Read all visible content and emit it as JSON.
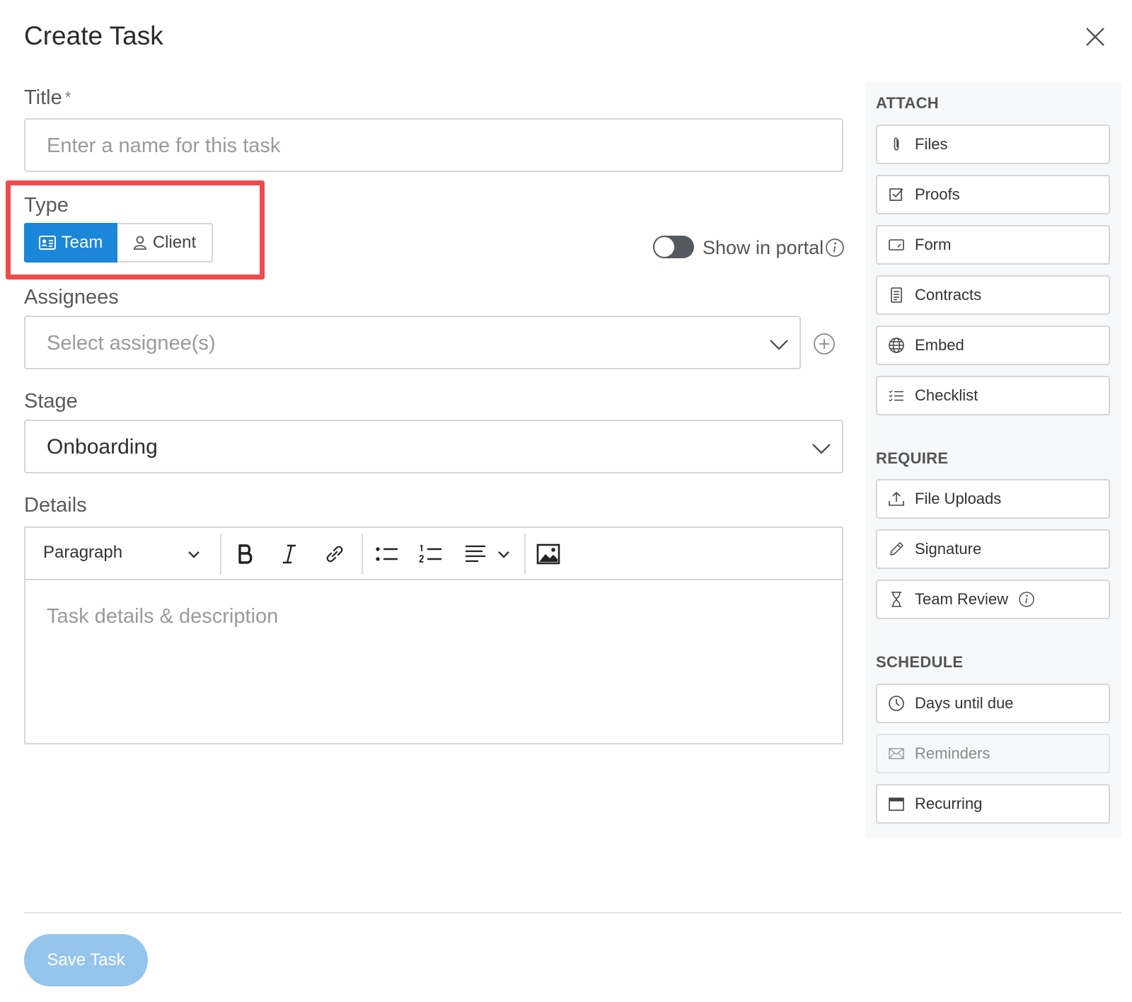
{
  "dialog": {
    "title": "Create Task"
  },
  "title_field": {
    "label": "Title",
    "required_mark": "*",
    "placeholder": "Enter a name for this task"
  },
  "type_field": {
    "label": "Type",
    "options": [
      {
        "label": "Team",
        "selected": true
      },
      {
        "label": "Client",
        "selected": false
      }
    ]
  },
  "portal": {
    "label": "Show in portal",
    "enabled": false
  },
  "assignees": {
    "label": "Assignees",
    "placeholder": "Select assignee(s)"
  },
  "stage": {
    "label": "Stage",
    "value": "Onboarding"
  },
  "details": {
    "label": "Details",
    "block_format": "Paragraph",
    "placeholder": "Task details & description"
  },
  "sidebar": {
    "attach": {
      "heading": "ATTACH",
      "items": [
        {
          "label": "Files",
          "icon": "paperclip-icon"
        },
        {
          "label": "Proofs",
          "icon": "checkbox-icon"
        },
        {
          "label": "Form",
          "icon": "form-icon"
        },
        {
          "label": "Contracts",
          "icon": "document-icon"
        },
        {
          "label": "Embed",
          "icon": "globe-icon"
        },
        {
          "label": "Checklist",
          "icon": "list-check-icon"
        }
      ]
    },
    "require": {
      "heading": "REQUIRE",
      "items": [
        {
          "label": "File Uploads",
          "icon": "upload-icon"
        },
        {
          "label": "Signature",
          "icon": "pen-icon"
        },
        {
          "label": "Team Review",
          "icon": "hourglass-icon"
        }
      ]
    },
    "schedule": {
      "heading": "SCHEDULE",
      "items": [
        {
          "label": "Days until due",
          "icon": "clock-icon"
        },
        {
          "label": "Reminders",
          "icon": "envelope-icon",
          "disabled": true
        },
        {
          "label": "Recurring",
          "icon": "calendar-icon"
        }
      ]
    }
  },
  "footer": {
    "save_label": "Save Task"
  },
  "colors": {
    "primary": "#1c87d9",
    "save_button": "#96c5ec",
    "highlight": "#f2494d"
  }
}
